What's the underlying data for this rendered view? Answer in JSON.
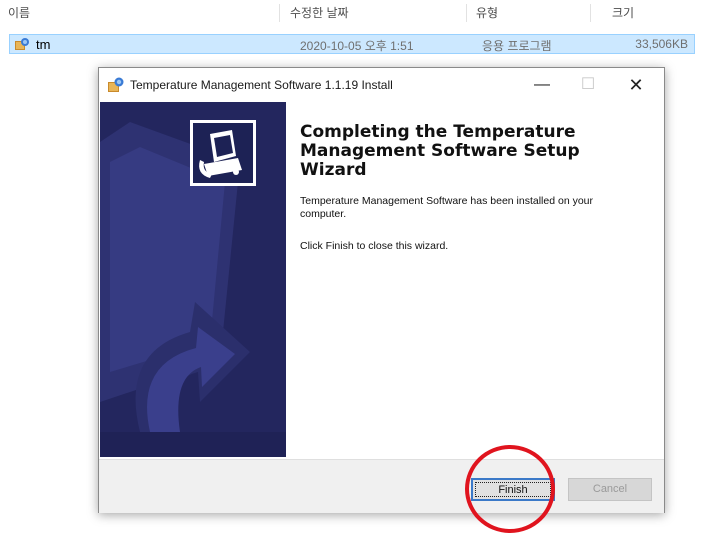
{
  "explorer": {
    "columns": [
      "이름",
      "수정한 날짜",
      "유형",
      "크기"
    ],
    "file": {
      "name": "tm",
      "date": "2020-10-05 오후 1:51",
      "type": "응용 프로그램",
      "size": "33,506KB",
      "icon": "installer-icon"
    }
  },
  "dialog": {
    "title": "Temperature Management Software 1.1.19 Install",
    "heading": "Completing the Temperature Management Software Setup Wizard",
    "message": "Temperature Management Software has been installed on your computer.",
    "instruction": "Click Finish to close this wizard.",
    "buttons": {
      "finish": "Finish",
      "cancel": "Cancel"
    },
    "window_controls": {
      "minimize": "—",
      "maximize": "☐",
      "close": "✕"
    }
  },
  "annotation": {
    "highlight_color": "#e0141e"
  },
  "colors": {
    "banner": "#23265e",
    "selection": "#cce8ff",
    "accent": "#3b79c8"
  }
}
